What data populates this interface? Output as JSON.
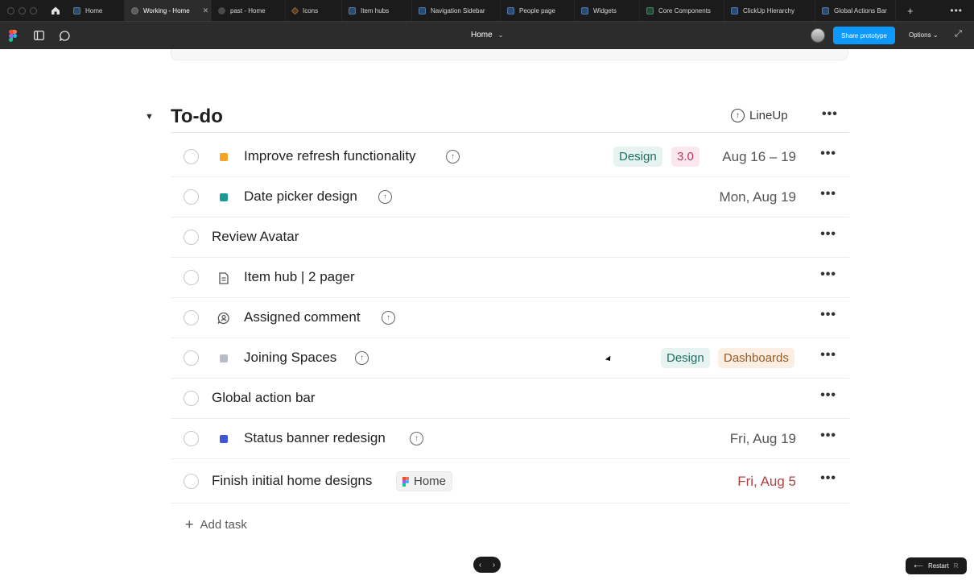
{
  "tabs": [
    {
      "label": "Home",
      "icon": "figma-file-icon",
      "active": false
    },
    {
      "label": "Working - Home",
      "icon": "play-icon",
      "active": true
    },
    {
      "label": "past - Home",
      "icon": "dot-icon",
      "active": false
    },
    {
      "label": "Icons",
      "icon": "diamond-icon",
      "active": false
    },
    {
      "label": "Item hubs",
      "icon": "figma-file-icon",
      "active": false
    },
    {
      "label": "Navigation Sidebar",
      "icon": "figma-file-icon",
      "active": false
    },
    {
      "label": "People page",
      "icon": "figma-file-icon",
      "active": false
    },
    {
      "label": "Widgets",
      "icon": "figma-file-icon",
      "active": false
    },
    {
      "label": "Core Components",
      "icon": "component-icon",
      "active": false
    },
    {
      "label": "ClickUp Hierarchy",
      "icon": "figma-file-icon",
      "active": false
    },
    {
      "label": "Global Actions Bar",
      "icon": "figma-file-icon",
      "active": false
    }
  ],
  "toolbar": {
    "title": "Home",
    "share_label": "Share prototype",
    "options_label": "Options"
  },
  "section": {
    "title": "To-do",
    "lineup_label": "LineUp"
  },
  "tasks": [
    {
      "name": "Improve refresh functionality",
      "square_color": "#f5a524",
      "tags": [
        "Design",
        "3.0"
      ],
      "date": "Aug 16 – 19"
    },
    {
      "name": "Date picker design",
      "square_color": "#1a9a94",
      "tags": [],
      "date": "Mon, Aug 19"
    },
    {
      "name": "Review Avatar",
      "tags": [],
      "date": ""
    },
    {
      "name": "Item hub | 2 pager",
      "icon": "document-icon",
      "tags": [],
      "date": ""
    },
    {
      "name": "Assigned comment",
      "icon": "assigned-comment-icon",
      "tags": [],
      "date": ""
    },
    {
      "name": "Joining Spaces",
      "square_color": "#b7bcc7",
      "tags": [
        "Design",
        "Dashboards"
      ],
      "date": ""
    },
    {
      "name": "Global action bar",
      "tags": [],
      "date": ""
    },
    {
      "name": "Status banner redesign",
      "square_color": "#3e57d6",
      "tags": [],
      "date": "Fri, Aug 19"
    },
    {
      "name": "Finish initial home designs",
      "tags": [
        "Home"
      ],
      "date": "Fri, Aug 5",
      "date_color": "#b34040"
    }
  ],
  "add_task_label": "Add task",
  "restart": {
    "label": "Restart",
    "key": "R"
  }
}
